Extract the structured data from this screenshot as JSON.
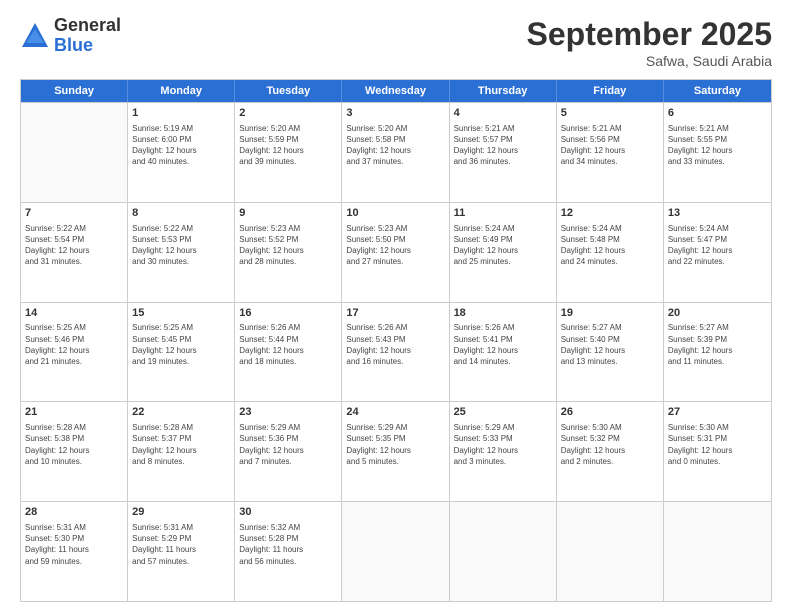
{
  "logo": {
    "general": "General",
    "blue": "Blue"
  },
  "title": "September 2025",
  "subtitle": "Safwa, Saudi Arabia",
  "header_days": [
    "Sunday",
    "Monday",
    "Tuesday",
    "Wednesday",
    "Thursday",
    "Friday",
    "Saturday"
  ],
  "weeks": [
    [
      {
        "day": "",
        "info": ""
      },
      {
        "day": "1",
        "info": "Sunrise: 5:19 AM\nSunset: 6:00 PM\nDaylight: 12 hours\nand 40 minutes."
      },
      {
        "day": "2",
        "info": "Sunrise: 5:20 AM\nSunset: 5:59 PM\nDaylight: 12 hours\nand 39 minutes."
      },
      {
        "day": "3",
        "info": "Sunrise: 5:20 AM\nSunset: 5:58 PM\nDaylight: 12 hours\nand 37 minutes."
      },
      {
        "day": "4",
        "info": "Sunrise: 5:21 AM\nSunset: 5:57 PM\nDaylight: 12 hours\nand 36 minutes."
      },
      {
        "day": "5",
        "info": "Sunrise: 5:21 AM\nSunset: 5:56 PM\nDaylight: 12 hours\nand 34 minutes."
      },
      {
        "day": "6",
        "info": "Sunrise: 5:21 AM\nSunset: 5:55 PM\nDaylight: 12 hours\nand 33 minutes."
      }
    ],
    [
      {
        "day": "7",
        "info": "Sunrise: 5:22 AM\nSunset: 5:54 PM\nDaylight: 12 hours\nand 31 minutes."
      },
      {
        "day": "8",
        "info": "Sunrise: 5:22 AM\nSunset: 5:53 PM\nDaylight: 12 hours\nand 30 minutes."
      },
      {
        "day": "9",
        "info": "Sunrise: 5:23 AM\nSunset: 5:52 PM\nDaylight: 12 hours\nand 28 minutes."
      },
      {
        "day": "10",
        "info": "Sunrise: 5:23 AM\nSunset: 5:50 PM\nDaylight: 12 hours\nand 27 minutes."
      },
      {
        "day": "11",
        "info": "Sunrise: 5:24 AM\nSunset: 5:49 PM\nDaylight: 12 hours\nand 25 minutes."
      },
      {
        "day": "12",
        "info": "Sunrise: 5:24 AM\nSunset: 5:48 PM\nDaylight: 12 hours\nand 24 minutes."
      },
      {
        "day": "13",
        "info": "Sunrise: 5:24 AM\nSunset: 5:47 PM\nDaylight: 12 hours\nand 22 minutes."
      }
    ],
    [
      {
        "day": "14",
        "info": "Sunrise: 5:25 AM\nSunset: 5:46 PM\nDaylight: 12 hours\nand 21 minutes."
      },
      {
        "day": "15",
        "info": "Sunrise: 5:25 AM\nSunset: 5:45 PM\nDaylight: 12 hours\nand 19 minutes."
      },
      {
        "day": "16",
        "info": "Sunrise: 5:26 AM\nSunset: 5:44 PM\nDaylight: 12 hours\nand 18 minutes."
      },
      {
        "day": "17",
        "info": "Sunrise: 5:26 AM\nSunset: 5:43 PM\nDaylight: 12 hours\nand 16 minutes."
      },
      {
        "day": "18",
        "info": "Sunrise: 5:26 AM\nSunset: 5:41 PM\nDaylight: 12 hours\nand 14 minutes."
      },
      {
        "day": "19",
        "info": "Sunrise: 5:27 AM\nSunset: 5:40 PM\nDaylight: 12 hours\nand 13 minutes."
      },
      {
        "day": "20",
        "info": "Sunrise: 5:27 AM\nSunset: 5:39 PM\nDaylight: 12 hours\nand 11 minutes."
      }
    ],
    [
      {
        "day": "21",
        "info": "Sunrise: 5:28 AM\nSunset: 5:38 PM\nDaylight: 12 hours\nand 10 minutes."
      },
      {
        "day": "22",
        "info": "Sunrise: 5:28 AM\nSunset: 5:37 PM\nDaylight: 12 hours\nand 8 minutes."
      },
      {
        "day": "23",
        "info": "Sunrise: 5:29 AM\nSunset: 5:36 PM\nDaylight: 12 hours\nand 7 minutes."
      },
      {
        "day": "24",
        "info": "Sunrise: 5:29 AM\nSunset: 5:35 PM\nDaylight: 12 hours\nand 5 minutes."
      },
      {
        "day": "25",
        "info": "Sunrise: 5:29 AM\nSunset: 5:33 PM\nDaylight: 12 hours\nand 3 minutes."
      },
      {
        "day": "26",
        "info": "Sunrise: 5:30 AM\nSunset: 5:32 PM\nDaylight: 12 hours\nand 2 minutes."
      },
      {
        "day": "27",
        "info": "Sunrise: 5:30 AM\nSunset: 5:31 PM\nDaylight: 12 hours\nand 0 minutes."
      }
    ],
    [
      {
        "day": "28",
        "info": "Sunrise: 5:31 AM\nSunset: 5:30 PM\nDaylight: 11 hours\nand 59 minutes."
      },
      {
        "day": "29",
        "info": "Sunrise: 5:31 AM\nSunset: 5:29 PM\nDaylight: 11 hours\nand 57 minutes."
      },
      {
        "day": "30",
        "info": "Sunrise: 5:32 AM\nSunset: 5:28 PM\nDaylight: 11 hours\nand 56 minutes."
      },
      {
        "day": "",
        "info": ""
      },
      {
        "day": "",
        "info": ""
      },
      {
        "day": "",
        "info": ""
      },
      {
        "day": "",
        "info": ""
      }
    ]
  ]
}
